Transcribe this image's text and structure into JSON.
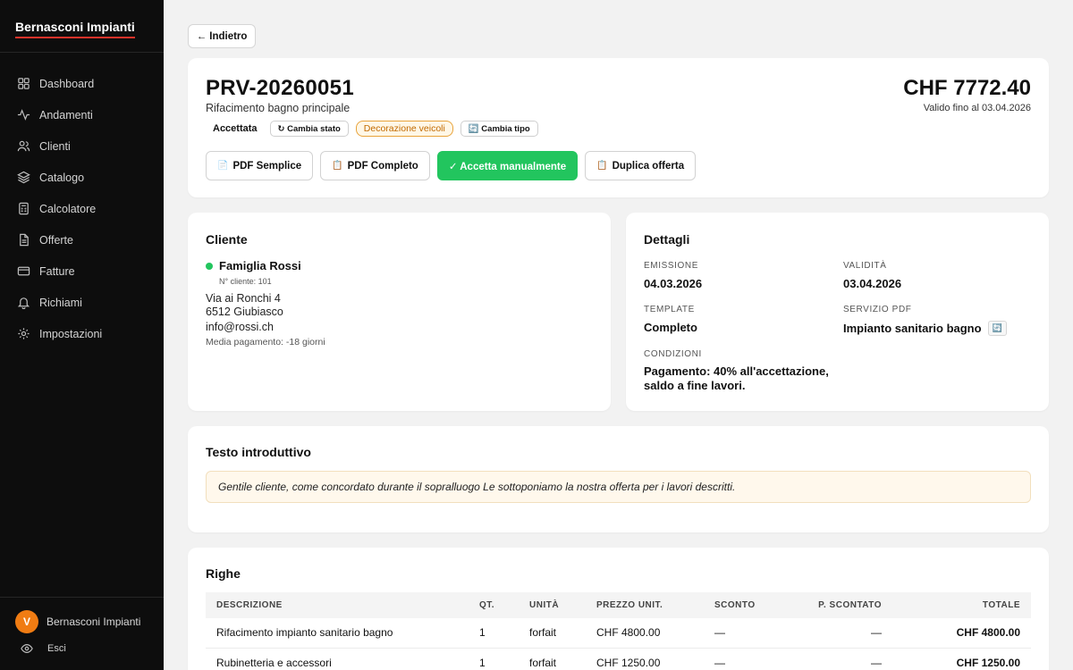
{
  "sidebar": {
    "brand": "Bernasconi Impianti",
    "items": [
      {
        "label": "Dashboard",
        "icon": "grid-icon"
      },
      {
        "label": "Andamenti",
        "icon": "activity-icon"
      },
      {
        "label": "Clienti",
        "icon": "users-icon"
      },
      {
        "label": "Catalogo",
        "icon": "layers-icon"
      },
      {
        "label": "Calcolatore",
        "icon": "calculator-icon"
      },
      {
        "label": "Offerte",
        "icon": "file-text-icon"
      },
      {
        "label": "Fatture",
        "icon": "credit-card-icon"
      },
      {
        "label": "Richiami",
        "icon": "bell-icon"
      },
      {
        "label": "Impostazioni",
        "icon": "gear-icon"
      }
    ],
    "user": {
      "initial": "V",
      "name": "Bernasconi Impianti"
    },
    "logout": "Esci"
  },
  "back_label": "← Indietro",
  "offer": {
    "number": "PRV-20260051",
    "subtitle": "Rifacimento bagno principale",
    "total": "CHF 7772.40",
    "valid_until": "Valido fino al 03.04.2026",
    "status": "Accettata",
    "change_status": "↻ Cambia stato",
    "type_badge": "Decorazione veicoli",
    "change_type": "🔄 Cambia tipo",
    "actions": {
      "pdf_simple": "PDF Semplice",
      "pdf_full": "PDF Completo",
      "accept": "✓ Accetta manualmente",
      "duplicate": "Duplica offerta"
    }
  },
  "client": {
    "title": "Cliente",
    "name": "Famiglia Rossi",
    "number": "N° cliente: 101",
    "street": "Via ai Ronchi 4",
    "city": "6512 Giubiasco",
    "email": "info@rossi.ch",
    "payment_avg": "Media pagamento: -18 giorni"
  },
  "details": {
    "title": "Dettagli",
    "emission_label": "Emissione",
    "emission": "04.03.2026",
    "validity_label": "Validità",
    "validity": "03.04.2026",
    "template_label": "Template",
    "template": "Completo",
    "pdf_service_label": "Servizio PDF",
    "pdf_service": "Impianto sanitario bagno",
    "conditions_label": "Condizioni",
    "conditions_1": "Pagamento: 40% all'accettazione,",
    "conditions_2": "saldo a fine lavori."
  },
  "intro": {
    "title": "Testo introduttivo",
    "text": "Gentile cliente, come concordato durante il sopralluogo Le sottoponiamo la nostra offerta per i lavori descritti."
  },
  "lines": {
    "title": "Righe",
    "headers": [
      "Descrizione",
      "Qt.",
      "Unità",
      "Prezzo unit.",
      "Sconto",
      "P. scontato",
      "Totale"
    ],
    "rows": [
      {
        "desc": "Rifacimento impianto sanitario bagno",
        "qty": "1",
        "unit": "forfait",
        "price": "CHF 4800.00",
        "discount": "—",
        "discounted": "—",
        "total": "CHF 4800.00"
      },
      {
        "desc": "Rubinetteria e accessori",
        "qty": "1",
        "unit": "forfait",
        "price": "CHF 1250.00",
        "discount": "—",
        "discounted": "—",
        "total": "CHF 1250.00"
      }
    ]
  }
}
